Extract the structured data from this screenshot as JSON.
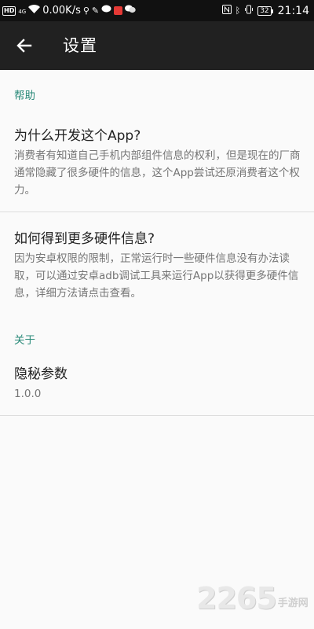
{
  "status_bar": {
    "hd": "HD",
    "net_type": "4G",
    "speed": "0.00K/s",
    "battery": "32",
    "time": "21:14"
  },
  "toolbar": {
    "back_icon": "back-arrow-icon",
    "title": "设置"
  },
  "sections": {
    "help": {
      "header": "帮助",
      "why": {
        "title": "为什么开发这个App?",
        "summary": "消费者有知道自己手机内部组件信息的权利，但是现在的厂商通常隐藏了很多硬件的信息，这个App尝试还原消费者这个权力。"
      },
      "more_info": {
        "title": "如何得到更多硬件信息?",
        "summary": "因为安卓权限的限制，正常运行时一些硬件信息没有办法读取，可以通过安卓adb调试工具来运行App以获得更多硬件信息，详细方法请点击查看。"
      }
    },
    "about": {
      "header": "关于",
      "privacy": {
        "title": "隐秘参数",
        "summary": "1.0.0"
      }
    }
  },
  "watermark": {
    "number": "2265",
    "text": "手游网"
  },
  "colors": {
    "status_bar_bg": "#111111",
    "toolbar_bg": "#212121",
    "accent": "#2a8a79",
    "background": "#fafafa"
  }
}
